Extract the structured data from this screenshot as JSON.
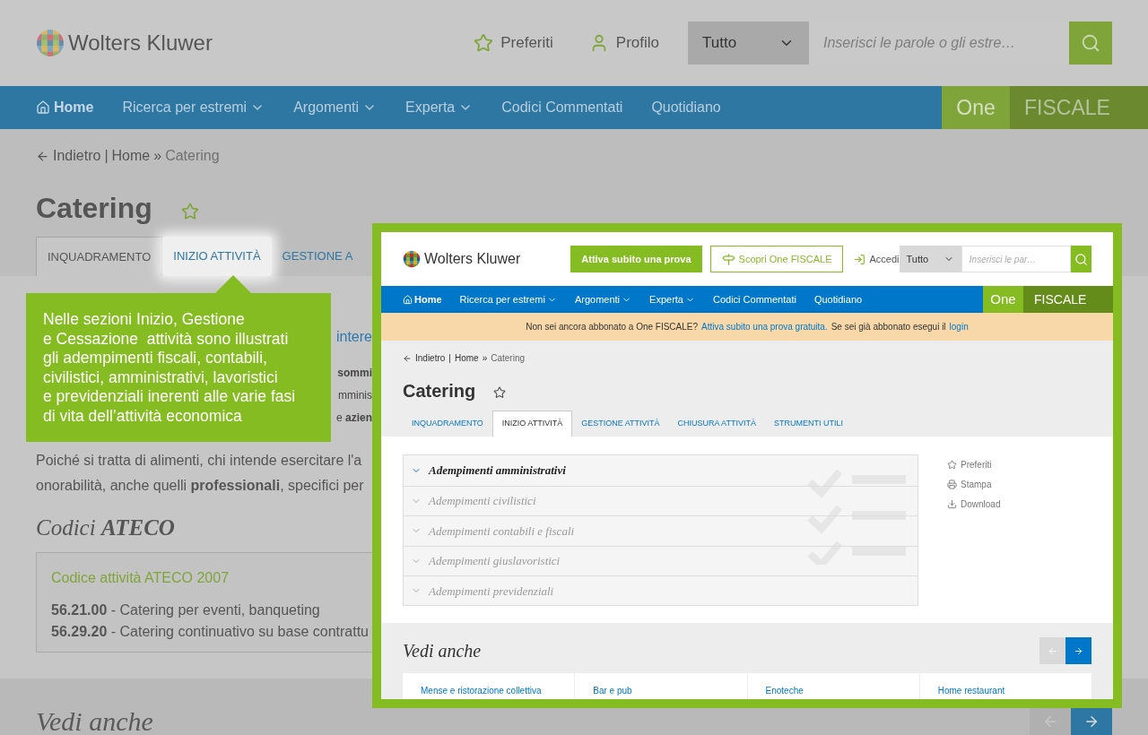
{
  "background_page": {
    "logo": "Wolters Kluwer",
    "header_links": [
      "Preferiti",
      "Profilo"
    ],
    "search": {
      "scope": "Tutto",
      "placeholder": "Inserisci le parole o gli estre…"
    },
    "nav": [
      {
        "label": "Home",
        "kind": "home",
        "dropdown": false
      },
      {
        "label": "Ricerca per estremi",
        "kind": "link",
        "dropdown": true
      },
      {
        "label": "Argomenti",
        "kind": "link",
        "dropdown": true
      },
      {
        "label": "Experta",
        "kind": "link",
        "dropdown": true
      },
      {
        "label": "Codici Commentati",
        "kind": "link",
        "dropdown": false
      },
      {
        "label": "Quotidiano",
        "kind": "link",
        "dropdown": false
      }
    ],
    "brand": {
      "one": "One",
      "product": "FISCALE"
    },
    "breadcrumb": {
      "back": "Indietro",
      "divider": "|",
      "separator": "»",
      "items": [
        "Home",
        "Catering"
      ]
    },
    "title": "Catering",
    "tabs": [
      {
        "label": "INQUADRAMENTO",
        "selected": true,
        "highlighted": false
      },
      {
        "label": "INIZIO ATTIVITÀ",
        "selected": false,
        "highlighted": true
      },
      {
        "label": "GESTIONE A",
        "selected": false,
        "highlighted": false
      }
    ],
    "fragments": [
      {
        "kind": "heading",
        "text": "intere"
      },
      {
        "kind": "text",
        "text": "**sommi**"
      },
      {
        "kind": "text",
        "text": "mminis"
      },
      {
        "kind": "text",
        "text": "e **azien**"
      }
    ],
    "paragraph_lines": [
      "Poiché si tratta di alimenti, chi intende esercitare l'a",
      "onorabilità, anche quelli **professionali**, specifici per"
    ],
    "codes_heading": "Codici **ATECO**",
    "codes_box": {
      "title": "Codice attività ATECO 2007",
      "rows": [
        "**56.21.00** - Catering per eventi, banqueting",
        "**56.29.20** - Catering continuativo su base contrattu"
      ]
    },
    "see_also": {
      "title": "Vedi anche",
      "prev_disabled": true,
      "next_disabled": false
    }
  },
  "tooltip": {
    "text": "Nelle sezioni Inizio, Gestione\ne Cessazione  attività sono illustrati\ngli adempimenti fiscali, contabili,\ncivilistici, amministrativi, lavoristici\ne previdenziali inerenti alle varie fasi\ndi vita dell’attività economica"
  },
  "inset": {
    "logo": "Wolters Kluwer",
    "trial_button": "Attiva subito una prova",
    "discover_button": "Scopri One FISCALE",
    "login": "Accedi",
    "search": {
      "scope": "Tutto",
      "placeholder": "Inserisci le par…"
    },
    "nav": [
      {
        "label": "Home",
        "kind": "home",
        "dropdown": false
      },
      {
        "label": "Ricerca per estremi",
        "kind": "link",
        "dropdown": true
      },
      {
        "label": "Argomenti",
        "kind": "link",
        "dropdown": true
      },
      {
        "label": "Experta",
        "kind": "link",
        "dropdown": true
      },
      {
        "label": "Codici Commentati",
        "kind": "link",
        "dropdown": false
      },
      {
        "label": "Quotidiano",
        "kind": "link",
        "dropdown": false
      }
    ],
    "brand": {
      "one": "One",
      "product": "FISCALE"
    },
    "banner": {
      "text": "Non sei ancora abbonato a One FISCALE?",
      "link": "Attiva subito una prova gratuita.",
      "text_2": "Se sei già abbonato esegui il",
      "link_2": "login"
    },
    "breadcrumb": {
      "back": "Indietro",
      "divider": "|",
      "separator": "»",
      "items": [
        "Home",
        "Catering"
      ]
    },
    "title": "Catering",
    "tabs": [
      {
        "label": "INQUADRAMENTO",
        "selected": false
      },
      {
        "label": "INIZIO ATTIVITÀ",
        "selected": true
      },
      {
        "label": "GESTIONE ATTIVITÀ",
        "selected": false
      },
      {
        "label": "CHIUSURA ATTIVITÀ",
        "selected": false
      },
      {
        "label": "STRUMENTI UTILI",
        "selected": false
      }
    ],
    "accordion": [
      {
        "label": "Adempimenti amministrativi",
        "selected": true
      },
      {
        "label": "Adempimenti civilistici",
        "selected": false
      },
      {
        "label": "Adempimenti contabili e fiscali",
        "selected": false
      },
      {
        "label": "Adempimenti giuslavoristici",
        "selected": false
      },
      {
        "label": "Adempimenti previdenziali",
        "selected": false
      }
    ],
    "actions": [
      {
        "label": "Preferiti",
        "kind": "star"
      },
      {
        "label": "Stampa",
        "kind": "print"
      },
      {
        "label": "Download",
        "kind": "download"
      }
    ],
    "see_also": {
      "title": "Vedi anche",
      "prev_disabled": true,
      "next_disabled": false,
      "cards": [
        "Mense e ristorazione collettiva",
        "Bar e pub",
        "Enoteche",
        "Home restaurant"
      ]
    }
  }
}
